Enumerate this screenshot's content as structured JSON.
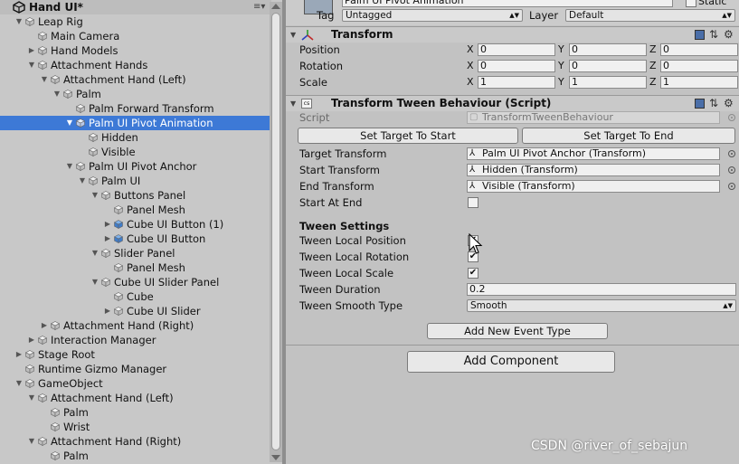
{
  "hierarchy": {
    "title": "Hand UI*",
    "menu_glyph": "≡▾",
    "items": [
      {
        "label": "Leap Rig",
        "depth": 1,
        "arrow": "down"
      },
      {
        "label": "Main Camera",
        "depth": 2,
        "arrow": ""
      },
      {
        "label": "Hand Models",
        "depth": 2,
        "arrow": "right"
      },
      {
        "label": "Attachment Hands",
        "depth": 2,
        "arrow": "down"
      },
      {
        "label": "Attachment Hand (Left)",
        "depth": 3,
        "arrow": "down"
      },
      {
        "label": "Palm",
        "depth": 4,
        "arrow": "down"
      },
      {
        "label": "Palm Forward Transform",
        "depth": 5,
        "arrow": ""
      },
      {
        "label": "Palm UI Pivot Animation",
        "depth": 5,
        "arrow": "down",
        "selected": true
      },
      {
        "label": "Hidden",
        "depth": 6,
        "arrow": ""
      },
      {
        "label": "Visible",
        "depth": 6,
        "arrow": ""
      },
      {
        "label": "Palm UI Pivot Anchor",
        "depth": 5,
        "arrow": "down"
      },
      {
        "label": "Palm UI",
        "depth": 6,
        "arrow": "down"
      },
      {
        "label": "Buttons Panel",
        "depth": 7,
        "arrow": "down"
      },
      {
        "label": "Panel Mesh",
        "depth": 8,
        "arrow": ""
      },
      {
        "label": "Cube UI Button (1)",
        "depth": 8,
        "arrow": "right",
        "prefab": true
      },
      {
        "label": "Cube UI Button",
        "depth": 8,
        "arrow": "right",
        "prefab": true
      },
      {
        "label": "Slider Panel",
        "depth": 7,
        "arrow": "down"
      },
      {
        "label": "Panel Mesh",
        "depth": 8,
        "arrow": ""
      },
      {
        "label": "Cube UI Slider Panel",
        "depth": 7,
        "arrow": "down"
      },
      {
        "label": "Cube",
        "depth": 8,
        "arrow": ""
      },
      {
        "label": "Cube UI Slider",
        "depth": 8,
        "arrow": "right"
      },
      {
        "label": "Attachment Hand (Right)",
        "depth": 3,
        "arrow": "right"
      },
      {
        "label": "Interaction Manager",
        "depth": 2,
        "arrow": "right"
      },
      {
        "label": "Stage Root",
        "depth": 1,
        "arrow": "right"
      },
      {
        "label": "Runtime Gizmo Manager",
        "depth": 1,
        "arrow": ""
      },
      {
        "label": "GameObject",
        "depth": 1,
        "arrow": "down"
      },
      {
        "label": "Attachment Hand (Left)",
        "depth": 2,
        "arrow": "down"
      },
      {
        "label": "Palm",
        "depth": 3,
        "arrow": ""
      },
      {
        "label": "Wrist",
        "depth": 3,
        "arrow": ""
      },
      {
        "label": "Attachment Hand (Right)",
        "depth": 2,
        "arrow": "down"
      },
      {
        "label": "Palm",
        "depth": 3,
        "arrow": ""
      }
    ]
  },
  "inspector": {
    "top": {
      "name_value": "Palm UI Pivot Animation",
      "static_label": "Static",
      "tag_label": "Tag",
      "tag_value": "Untagged",
      "layer_label": "Layer",
      "layer_value": "Default"
    },
    "transform": {
      "title": "Transform",
      "rows": [
        {
          "label": "Position",
          "x": "0",
          "y": "0",
          "z": "0"
        },
        {
          "label": "Rotation",
          "x": "0",
          "y": "0",
          "z": "0"
        },
        {
          "label": "Scale",
          "x": "1",
          "y": "1",
          "z": "1"
        }
      ],
      "axis_x": "X",
      "axis_y": "Y",
      "axis_z": "Z"
    },
    "tween": {
      "title": "Transform Tween Behaviour (Script)",
      "script_label": "Script",
      "script_value": "TransformTweenBehaviour",
      "set_start_label": "Set Target To Start",
      "set_end_label": "Set Target To End",
      "target_label": "Target Transform",
      "target_value": "Palm UI Pivot Anchor (Transform)",
      "start_label": "Start Transform",
      "start_value": "Hidden (Transform)",
      "end_label": "End Transform",
      "end_value": "Visible (Transform)",
      "start_at_end_label": "Start At End",
      "start_at_end": false,
      "settings_heading": "Tween Settings",
      "local_pos_label": "Tween Local Position",
      "local_pos": true,
      "local_rot_label": "Tween Local Rotation",
      "local_rot": true,
      "local_scale_label": "Tween Local Scale",
      "local_scale": true,
      "duration_label": "Tween Duration",
      "duration_value": "0.2",
      "smooth_label": "Tween Smooth Type",
      "smooth_value": "Smooth",
      "add_event_label": "Add New Event Type"
    },
    "add_component_label": "Add Component"
  },
  "watermark": "CSDN @river_of_sebajun",
  "colors": {
    "selection": "#3d79d6",
    "panel": "#c2c2c2"
  }
}
